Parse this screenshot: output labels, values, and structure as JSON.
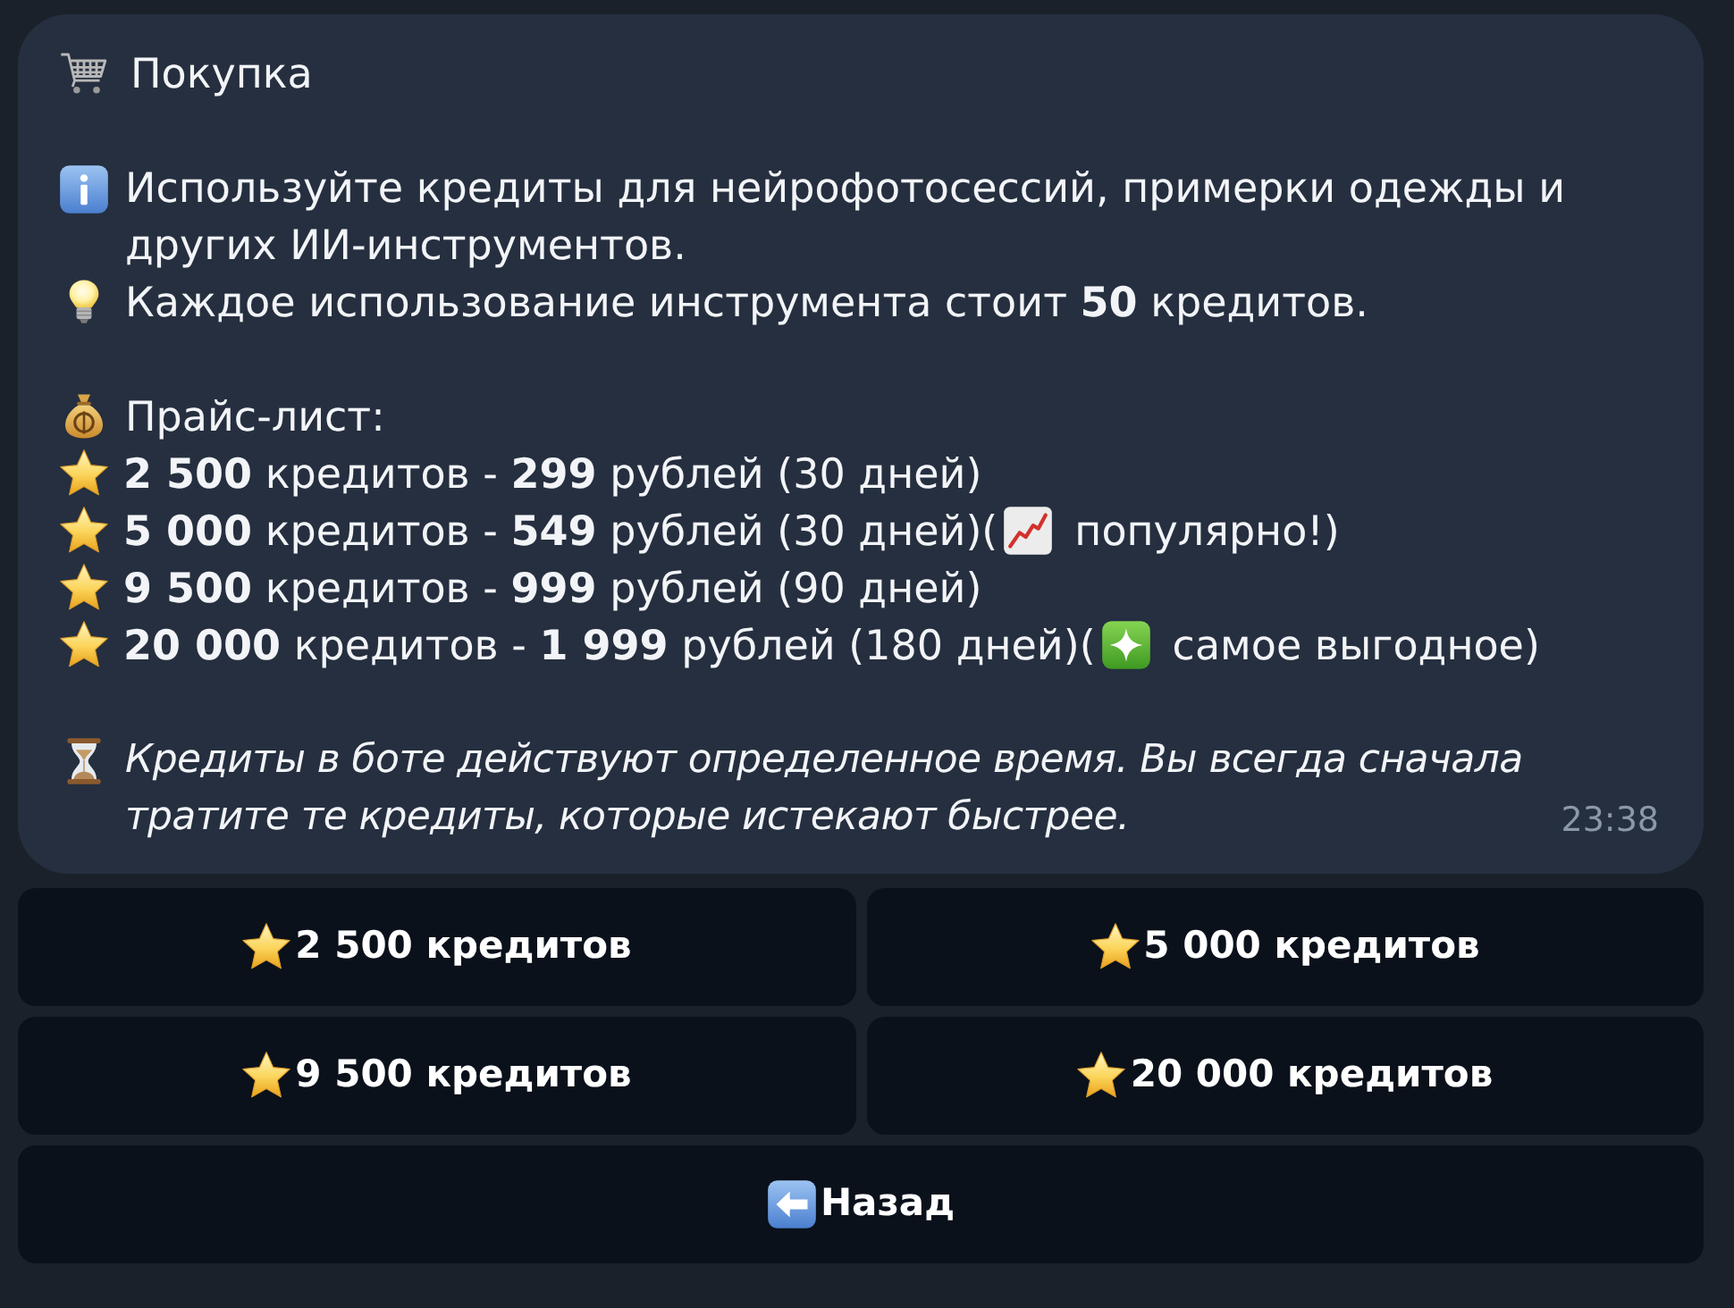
{
  "message": {
    "title": "Покупка",
    "intro": "Используйте кредиты для нейрофотосессий, примерки одежды и других ИИ-инструментов.",
    "cost_note": "Каждое использование инструмента стоит **50** кредитов.",
    "price_list_heading": "Прайс-лист:",
    "price_list": [
      {
        "text": "**2 500** кредитов - **299** рублей (30 дней)"
      },
      {
        "text": "**5 000** кредитов - **549** рублей (30 дней)(",
        "note": {
          "kind": "trending",
          "text": "популярно!)"
        }
      },
      {
        "text": "**9 500** кредитов - **999** рублей (90 дней)"
      },
      {
        "text": "**20 000** кредитов - **1 999** рублей (180 дней)(",
        "note": {
          "kind": "best",
          "text": "самое выгодное)"
        }
      }
    ],
    "expiry_note": "Кредиты в боте действуют определенное время. Вы всегда сначала тратите те кредиты, которые истекают быстрее.",
    "time": "23:38"
  },
  "keyboard": {
    "rows": [
      [
        {
          "kind": "credits",
          "label": "2 500 кредитов"
        },
        {
          "kind": "credits",
          "label": "5 000 кредитов"
        }
      ],
      [
        {
          "kind": "credits",
          "label": "9 500 кредитов"
        },
        {
          "kind": "credits",
          "label": "20 000 кредитов"
        }
      ],
      [
        {
          "kind": "back",
          "label": "Назад"
        }
      ]
    ]
  }
}
